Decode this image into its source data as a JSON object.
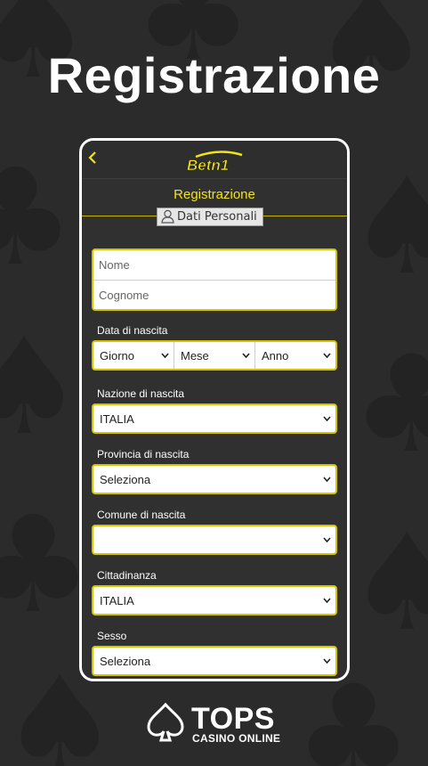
{
  "page": {
    "title": "Registrazione"
  },
  "app": {
    "logo_text": "Betn1"
  },
  "form": {
    "title": "Registrazione",
    "section_label": "Dati Personali",
    "nome_placeholder": "Nome",
    "cognome_placeholder": "Cognome",
    "birth_date": {
      "label": "Data di nascita",
      "day": "Giorno",
      "month": "Mese",
      "year": "Anno"
    },
    "birth_country": {
      "label": "Nazione di nascita",
      "value": "ITALIA"
    },
    "birth_province": {
      "label": "Provincia di nascita",
      "value": "Seleziona"
    },
    "birth_city": {
      "label": "Comune di nascita",
      "value": ""
    },
    "citizenship": {
      "label": "Cittadinanza",
      "value": "ITALIA"
    },
    "gender": {
      "label": "Sesso",
      "value": "Seleziona"
    }
  },
  "branding": {
    "name": "TOPS",
    "tagline": "CASINO ONLINE"
  },
  "colors": {
    "accent": "#f2e21a",
    "border": "#d6c300",
    "background": "#2b2b2b"
  }
}
